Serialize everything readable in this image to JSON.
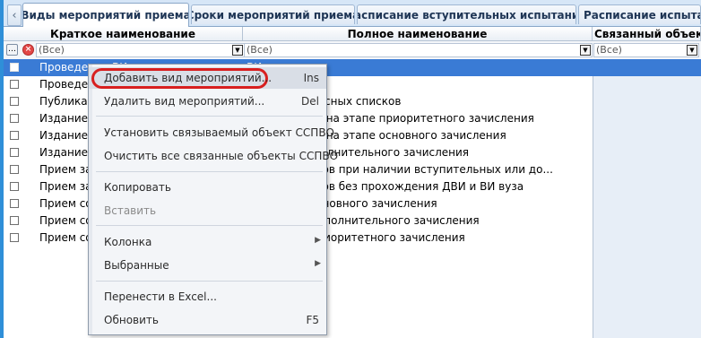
{
  "tabs": [
    {
      "label": "Виды мероприятий приема",
      "active": true
    },
    {
      "label": "Сроки мероприятий приема",
      "active": false
    },
    {
      "label": "Расписание вступительных испытаний",
      "active": false
    },
    {
      "label": "Расписание испытаний",
      "active": false
    }
  ],
  "nav_left_icon": "chevron-left-icon",
  "grid": {
    "headers": [
      "Краткое наименование",
      "Полное наименование",
      "Связанный объект ..."
    ],
    "filter": {
      "all": "(Все)"
    },
    "rows": [
      {
        "short": "Проведение ВИ",
        "full": "ВИ вуза",
        "selected": true
      },
      {
        "short": "Проведен",
        "full": "И",
        "selected": false
      },
      {
        "short": "Публикац",
        "full": "овных конкурсных списков",
        "selected": false
      },
      {
        "short": "Издание п",
        "full": "о зачислении на этапе приоритетного зачисления",
        "selected": false
      },
      {
        "short": "Издание п",
        "full": "о зачислении на этапе основного зачисления",
        "selected": false
      },
      {
        "short": "Издание п",
        "full": "на этапе дополнительного зачисления",
        "selected": false
      },
      {
        "short": "Прием за",
        "full": "й и документов при наличии вступительных или до...",
        "selected": false
      },
      {
        "short": "Прием за",
        "full": "й и документов без прохождения ДВИ и ВИ вуза",
        "selected": false
      },
      {
        "short": "Прием со",
        "full": "й на этапе основного зачисления",
        "selected": false
      },
      {
        "short": "Прием со",
        "full": "й на этапе дополнительного зачисления",
        "selected": false
      },
      {
        "short": "Прием со",
        "full": "й на этапе приоритетного зачисления",
        "selected": false
      }
    ]
  },
  "context_menu": {
    "items": [
      {
        "label": "Добавить вид мероприятий...",
        "shortcut": "Ins",
        "disabled": false,
        "highlighted": true
      },
      {
        "label": "Удалить вид мероприятий...",
        "shortcut": "Del",
        "disabled": false
      },
      {
        "label": "Установить связываемый объект ССПВО",
        "shortcut": "",
        "disabled": false
      },
      {
        "label": "Очистить все связанные объекты ССПВО",
        "shortcut": "",
        "disabled": false
      },
      {
        "label": "Копировать",
        "shortcut": "",
        "disabled": false
      },
      {
        "label": "Вставить",
        "shortcut": "",
        "disabled": true
      },
      {
        "label": "Колонка",
        "shortcut": "",
        "disabled": false,
        "submenu": true
      },
      {
        "label": "Выбранные",
        "shortcut": "",
        "disabled": false,
        "submenu": true
      },
      {
        "label": "Перенести в Excel...",
        "shortcut": "",
        "disabled": false
      },
      {
        "label": "Обновить",
        "shortcut": "F5",
        "disabled": false
      }
    ]
  },
  "colors": {
    "selection": "#3a7bd5",
    "highlight_oval": "#d81f1f",
    "tab_bar": "#d6e6f7"
  }
}
